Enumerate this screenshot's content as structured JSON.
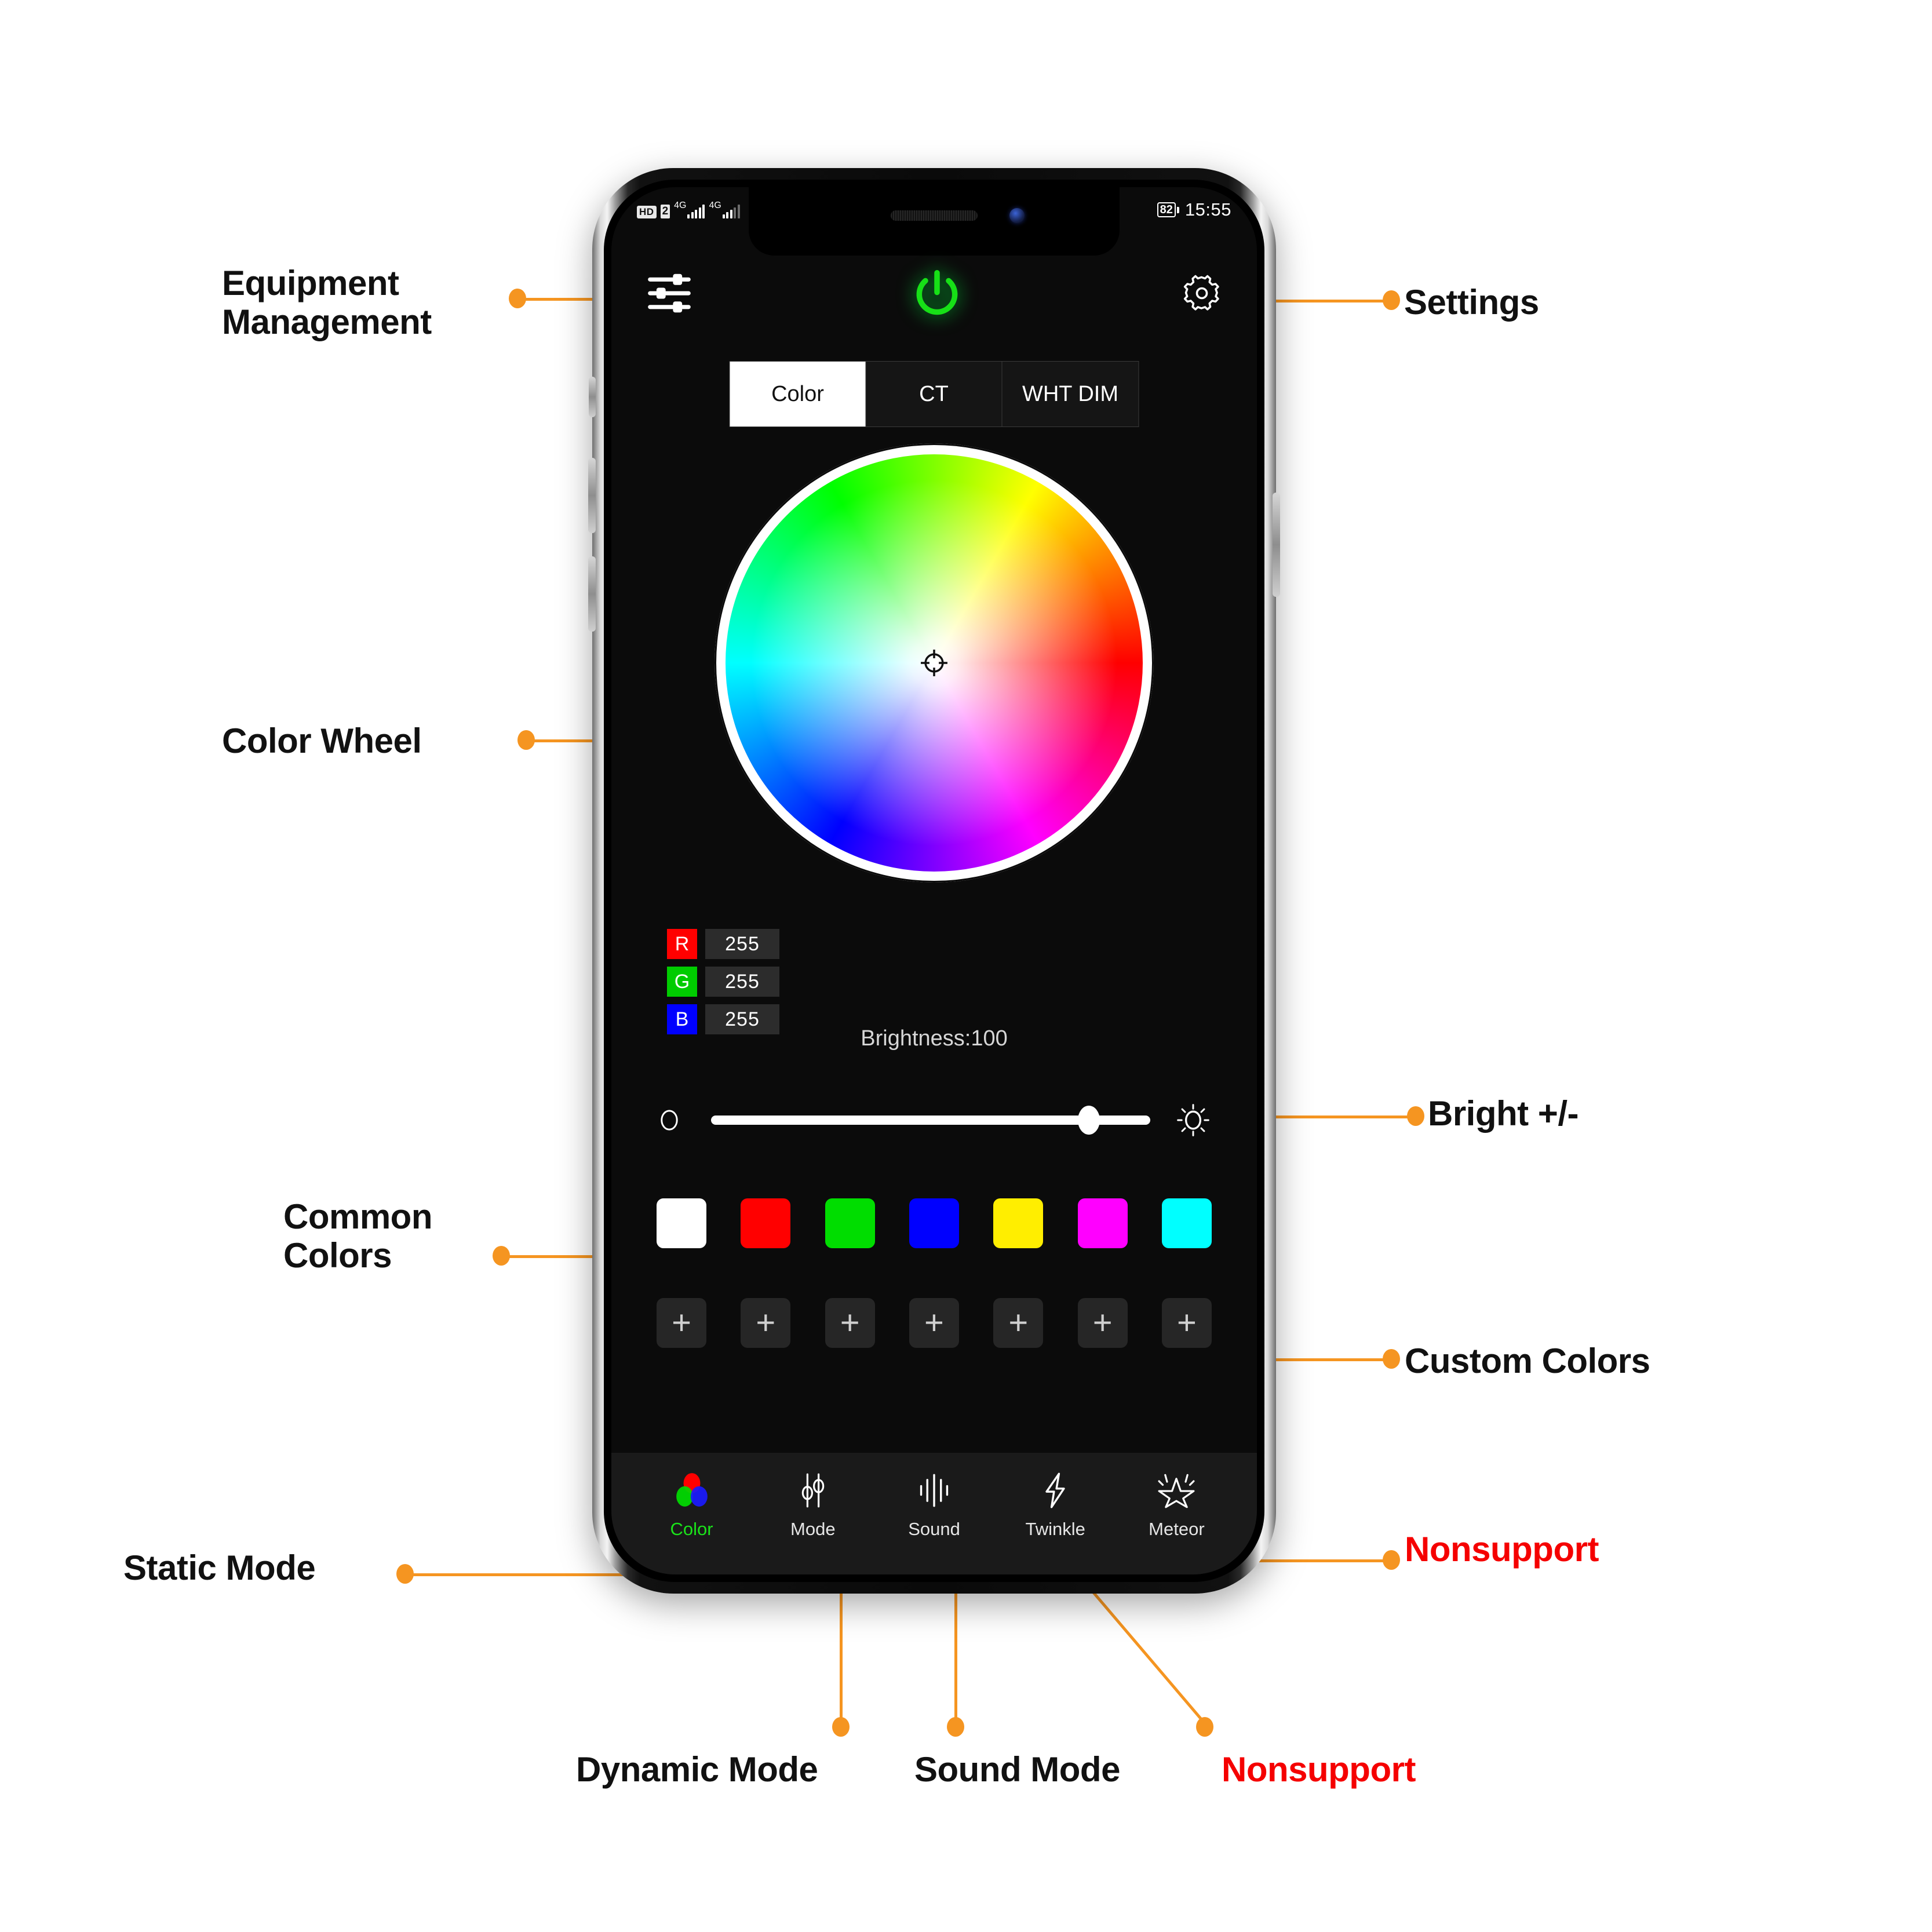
{
  "status_bar": {
    "hd_label": "HD",
    "sim_label": "2",
    "net1": "4G",
    "net2": "4G",
    "battery": "82",
    "time": "15:55"
  },
  "app_header": {
    "equipment_icon": "sliders-icon",
    "power_icon": "power-icon",
    "settings_icon": "gear-icon"
  },
  "mode_tabs": [
    {
      "label": "Color",
      "active": true
    },
    {
      "label": "CT",
      "active": false
    },
    {
      "label": "WHT DIM",
      "active": false
    }
  ],
  "color_wheel": {
    "selector_icon": "crosshair-icon"
  },
  "rgb": [
    {
      "channel": "R",
      "value": "255",
      "color": "#ff0000"
    },
    {
      "channel": "G",
      "value": "255",
      "color": "#00cc00"
    },
    {
      "channel": "B",
      "value": "255",
      "color": "#0000ff"
    }
  ],
  "brightness": {
    "label": "Brightness:100",
    "value": 100,
    "dim_icon": "dim-circle-icon",
    "bright_icon": "sun-icon",
    "thumb_position_pct": 86
  },
  "common_colors": [
    "#ffffff",
    "#ff0000",
    "#00dd00",
    "#0000ff",
    "#ffee00",
    "#ff00ff",
    "#00ffff"
  ],
  "custom_colors": {
    "plus_label": "+",
    "count": 7
  },
  "bottom_nav": [
    {
      "label": "Color",
      "icon": "rgb-circles-icon",
      "active": true
    },
    {
      "label": "Mode",
      "icon": "sliders-vertical-icon",
      "active": false
    },
    {
      "label": "Sound",
      "icon": "sound-wave-icon",
      "active": false
    },
    {
      "label": "Twinkle",
      "icon": "lightning-bolt-icon",
      "active": false
    },
    {
      "label": "Meteor",
      "icon": "sparkle-star-icon",
      "active": false
    }
  ],
  "annotations": {
    "equipment_management": "Equipment\nManagement",
    "settings": "Settings",
    "color_wheel": "Color Wheel",
    "bright": "Bright +/-",
    "common_colors": "Common\nColors",
    "custom_colors": "Custom Colors",
    "static_mode": "Static Mode",
    "nonsupport_right": "Nonsupport",
    "dynamic_mode": "Dynamic Mode",
    "sound_mode": "Sound Mode",
    "nonsupport_bottom": "Nonsupport"
  },
  "colors": {
    "accent": "#f59521",
    "nonsupport": "#f50000",
    "active_nav": "#1ae31a"
  }
}
